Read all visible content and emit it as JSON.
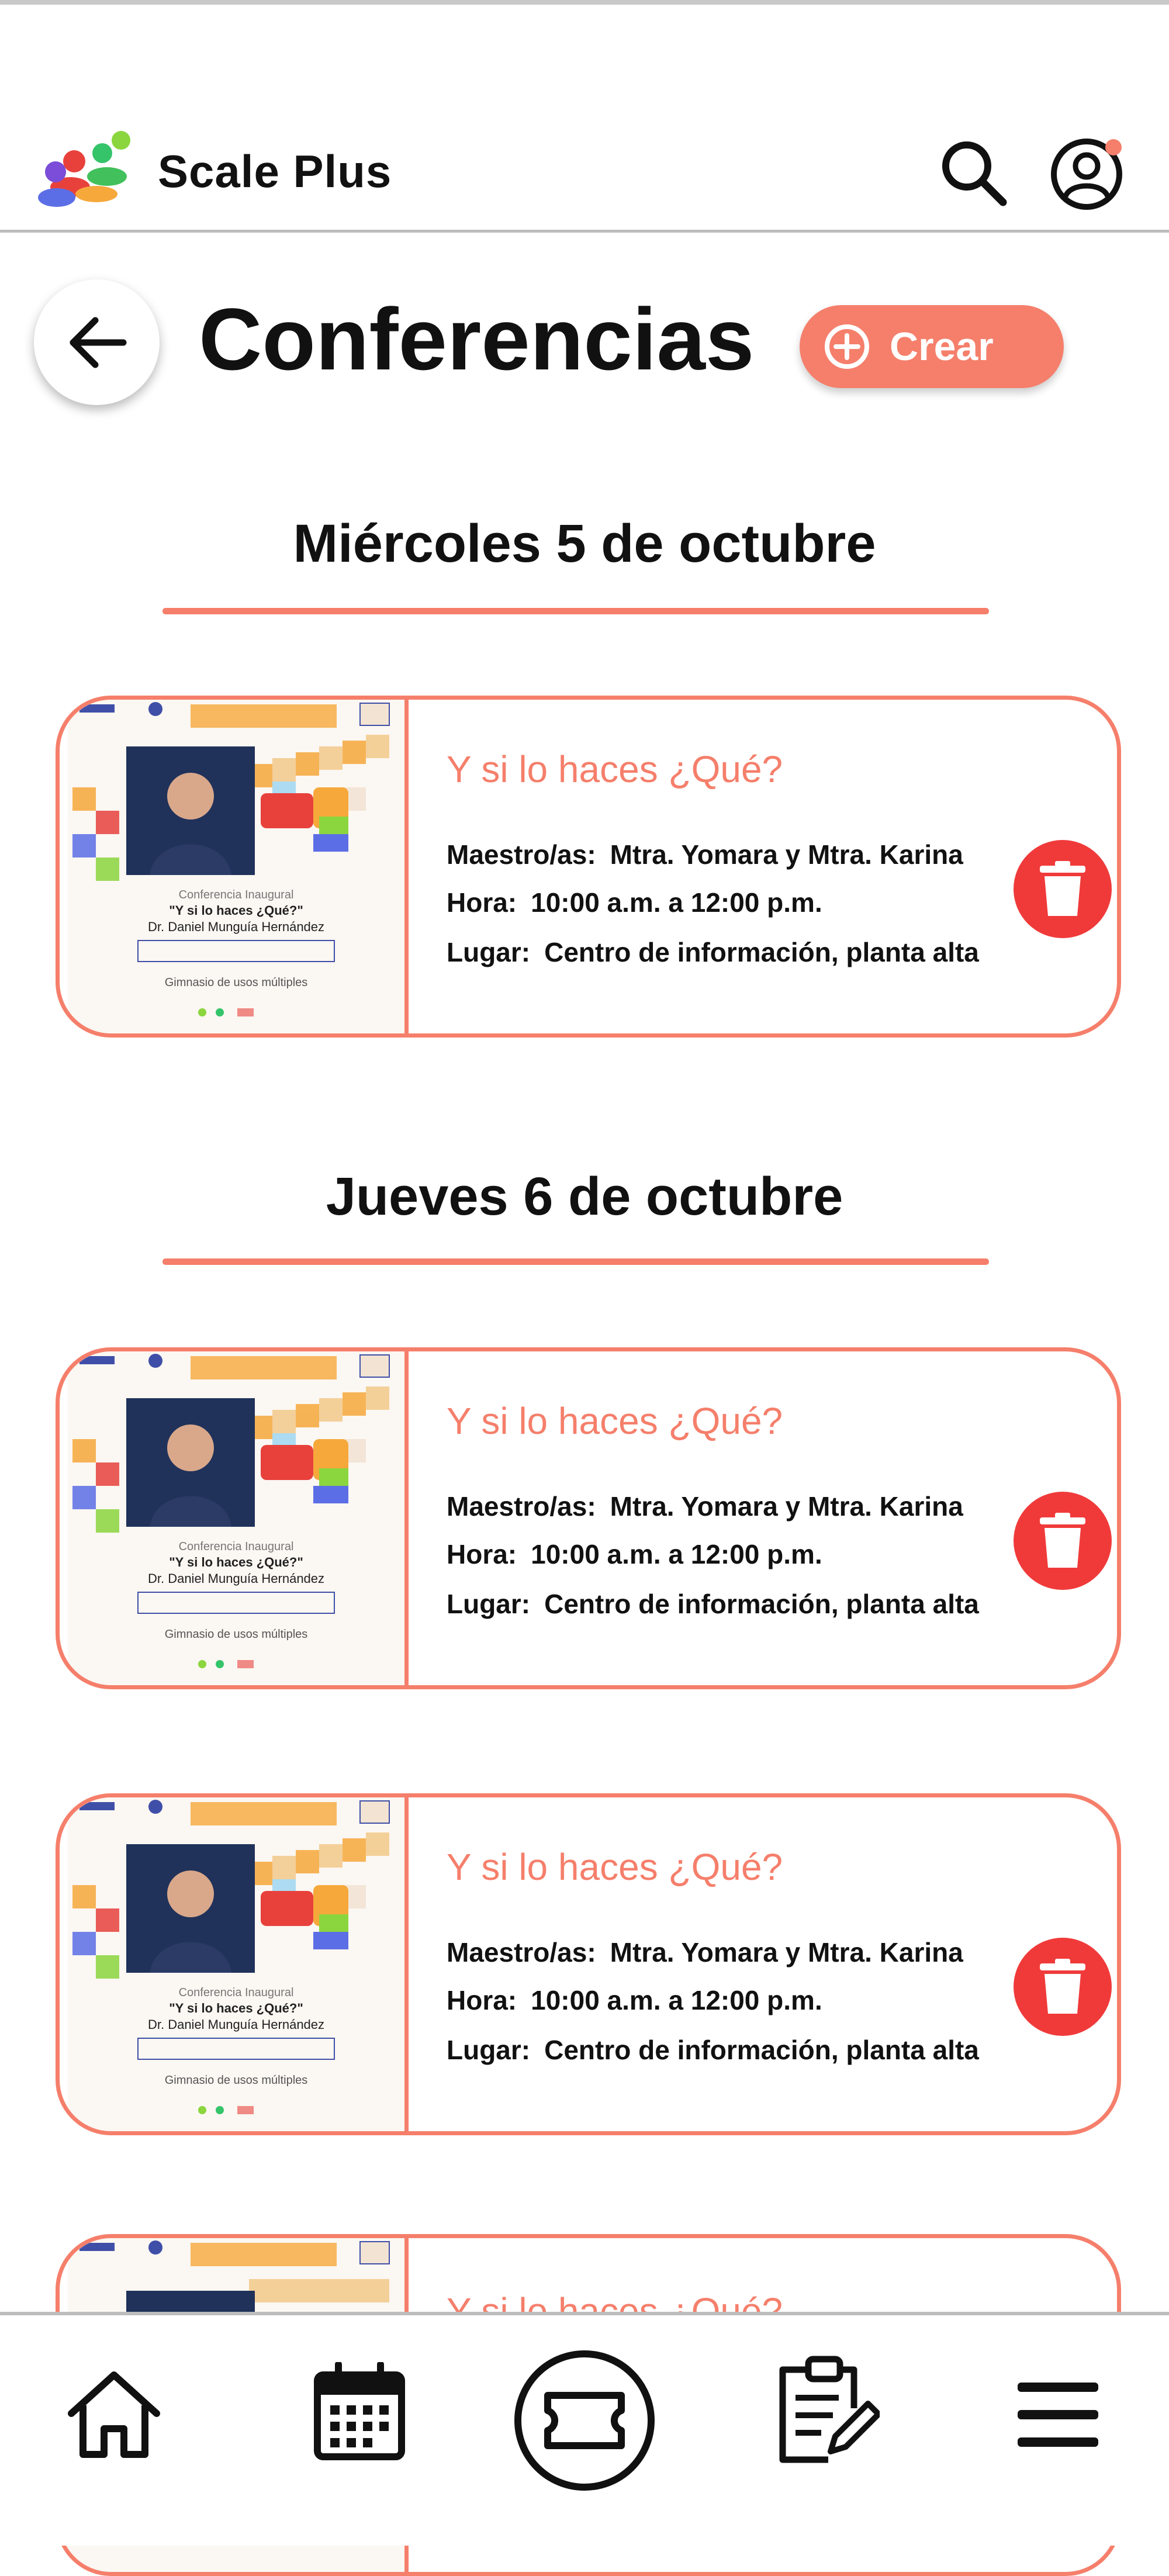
{
  "app": {
    "name": "Scale Plus"
  },
  "header": {
    "search_icon": "search-icon",
    "profile_icon": "user-circle-icon",
    "notification_dot_color": "#f57f6b"
  },
  "page": {
    "title": "Conferencias",
    "back_icon": "arrow-left-icon",
    "create_label": "Crear",
    "create_icon": "plus-circle-icon"
  },
  "colors": {
    "accent": "#f57f6b",
    "delete": "#f03a3a",
    "text": "#111111"
  },
  "days": [
    {
      "title": "Miércoles 5 de octubre",
      "events": [
        {
          "title": "Y si lo haces ¿Qué?",
          "teacher_label": "Maestro/as:",
          "teacher": "Mtra. Yomara y Mtra. Karina",
          "time_label": "Hora:",
          "time": "10:00 a.m. a 12:00 p.m.",
          "place_label": "Lugar:",
          "place": "Centro de información, planta alta",
          "poster": {
            "type": "Conferencia Inaugural",
            "title": "\"Y si lo haces ¿Qué?\"",
            "speaker": "Dr. Daniel Munguía Hernández",
            "venue": "Gimnasio de usos múltiples"
          }
        }
      ]
    },
    {
      "title": "Jueves 6 de octubre",
      "events": [
        {
          "title": "Y si lo haces ¿Qué?",
          "teacher_label": "Maestro/as:",
          "teacher": "Mtra. Yomara y Mtra. Karina",
          "time_label": "Hora:",
          "time": "10:00 a.m. a 12:00 p.m.",
          "place_label": "Lugar:",
          "place": "Centro de información, planta alta",
          "poster": {
            "type": "Conferencia Inaugural",
            "title": "\"Y si lo haces ¿Qué?\"",
            "speaker": "Dr. Daniel Munguía Hernández",
            "venue": "Gimnasio de usos múltiples"
          }
        },
        {
          "title": "Y si lo haces ¿Qué?",
          "teacher_label": "Maestro/as:",
          "teacher": "Mtra. Yomara y Mtra. Karina",
          "time_label": "Hora:",
          "time": "10:00 a.m. a 12:00 p.m.",
          "place_label": "Lugar:",
          "place": "Centro de información, planta alta",
          "poster": {
            "type": "Conferencia Inaugural",
            "title": "\"Y si lo haces ¿Qué?\"",
            "speaker": "Dr. Daniel Munguía Hernández",
            "venue": "Gimnasio de usos múltiples"
          }
        },
        {
          "title": "Y si lo haces ¿Qué?"
        }
      ]
    }
  ],
  "bottom_nav": [
    {
      "name": "home",
      "icon": "home-icon"
    },
    {
      "name": "calendar",
      "icon": "calendar-icon"
    },
    {
      "name": "tickets",
      "icon": "ticket-icon"
    },
    {
      "name": "tasks",
      "icon": "clipboard-edit-icon"
    },
    {
      "name": "menu",
      "icon": "hamburger-menu-icon"
    }
  ]
}
